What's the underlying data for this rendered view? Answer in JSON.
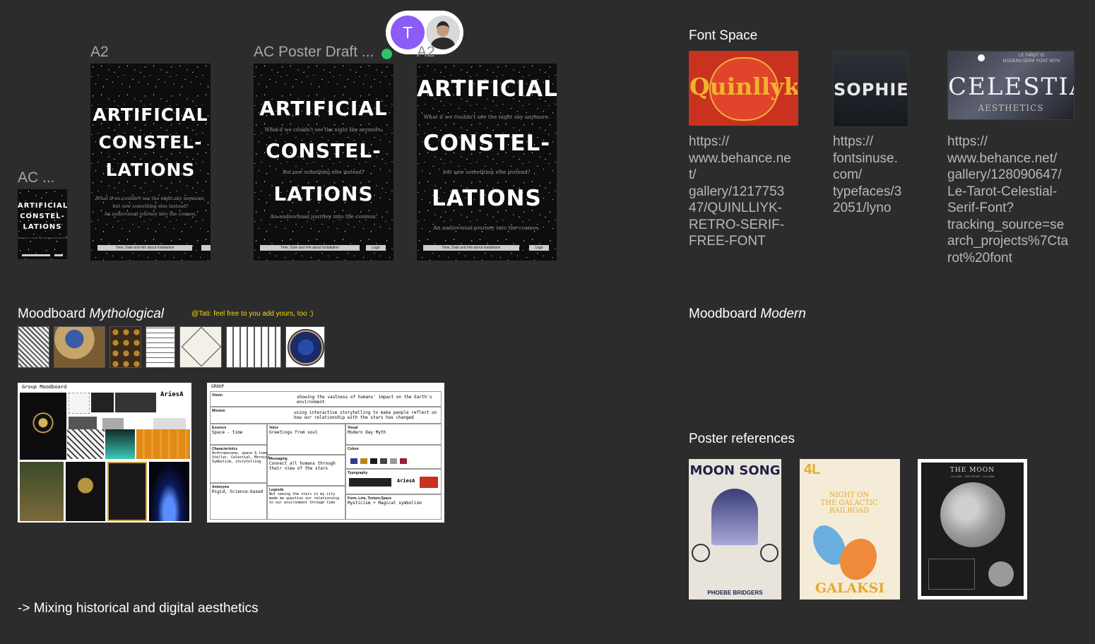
{
  "collaborators": {
    "avatar_initial": "T",
    "avatar_color": "#8b5cf6"
  },
  "frames": {
    "small_label": "AC ...",
    "a2_label": "A2",
    "draft_label": "AC Poster Draft ...",
    "third_label": "A2"
  },
  "poster": {
    "title_line1": "ARTIFICIAL",
    "title_line2": "CONSTEL-",
    "title_line3": "LATIONS",
    "tagline_a": "What if we couldn't see the night sky anymore,",
    "tagline_b": "but saw something else instead?",
    "tagline_c": "An audiovisual journey into the cosmos.",
    "tagline_full": "What if we couldn't see the night sky anymore.",
    "info_bar": "Time, Date and Info about Installation",
    "logo_bar": "Logo"
  },
  "font_space": {
    "title": "Font Space",
    "fonts": [
      {
        "name": "Quinllyk",
        "url": "https://\nwww.behance.ne\nt/\ngallery/1217753\n47/QUINLLIYK-\nRETRO-SERIF-\nFREE-FONT"
      },
      {
        "name": "SOPHIE",
        "url": "https://\nfontsinuse.\ncom/\ntypefaces/3\n2051/lyno"
      },
      {
        "name": "CELESTIAL",
        "subtitle": "AESTHETICS",
        "top_note": "LE TAROT IS\nMODERN SERIF FONT WITH",
        "url": "https://\nwww.behance.net/\ngallery/128090647/\nLe-Tarot-Celestial-\nSerif-Font?\ntracking_source=se\narch_projects%7Cta\nrot%20font"
      }
    ]
  },
  "moodboard_myth": {
    "title_plain": "Moodboard ",
    "title_italic": "Mythological",
    "comment": "@Tati: feel free to you add yours, too :)",
    "comment_color": "#f5d90a"
  },
  "group_board": {
    "header": "Group  Moodboard",
    "aries": "AriesA"
  },
  "brand_sheet": {
    "group": "GROUP",
    "vision_label": "Vision",
    "vision_text": "showing the vastness of humans' impact on the Earth's environment",
    "mission_label": "Mission",
    "mission_text": "using interactive storytelling to make people reflect on how our relationship with the stars has changed",
    "essence_label": "Essence",
    "essence_text": "Space - time",
    "voice_label": "Voice",
    "voice_text": "Greetings from soul",
    "visual_label": "Visual",
    "visual_text": "Modern Day Myth",
    "characteristics_label": "Characteristics",
    "characteristics_text": "Anthropocene, space & time\nStellar, Celestial, Morning\nSymbolism, storytelling",
    "messaging_label": "Messaging",
    "messaging_text": "Connect all humans through their view of the stars",
    "colour_label": "Colour",
    "typography_label": "Typography",
    "antonyms_label": "Antonyms",
    "antonyms_text": "Rigid, Science-based",
    "legends_label": "Legends",
    "legends_text": "Not seeing the stars in my city made me question our relationship to our environment through time",
    "form_label": "Form, Line, Texture,Space",
    "form_text": "Mysticism + Magical symbolism",
    "swatches": [
      "#2a3c8c",
      "#b8861b",
      "#1a1a1a",
      "#444444",
      "#999999",
      "#9b1f3a"
    ]
  },
  "moodboard_modern": {
    "title_plain": "Moodboard ",
    "title_italic": "Modern"
  },
  "poster_refs": {
    "title": "Poster references",
    "moon_song": "MOON SONG",
    "moon_song_artist": "PHOEBE BRIDGERS",
    "galaksi_top": "NIGHT ON\nTHE GALACTIC\nRAILROAD",
    "galaksi_bottom": "GALAKSI",
    "the_moon": "THE MOON",
    "the_moon_sub": "LA LUNE · DER MOND · LA LUNA"
  },
  "footer_note": "-> Mixing historical and digital aesthetics"
}
